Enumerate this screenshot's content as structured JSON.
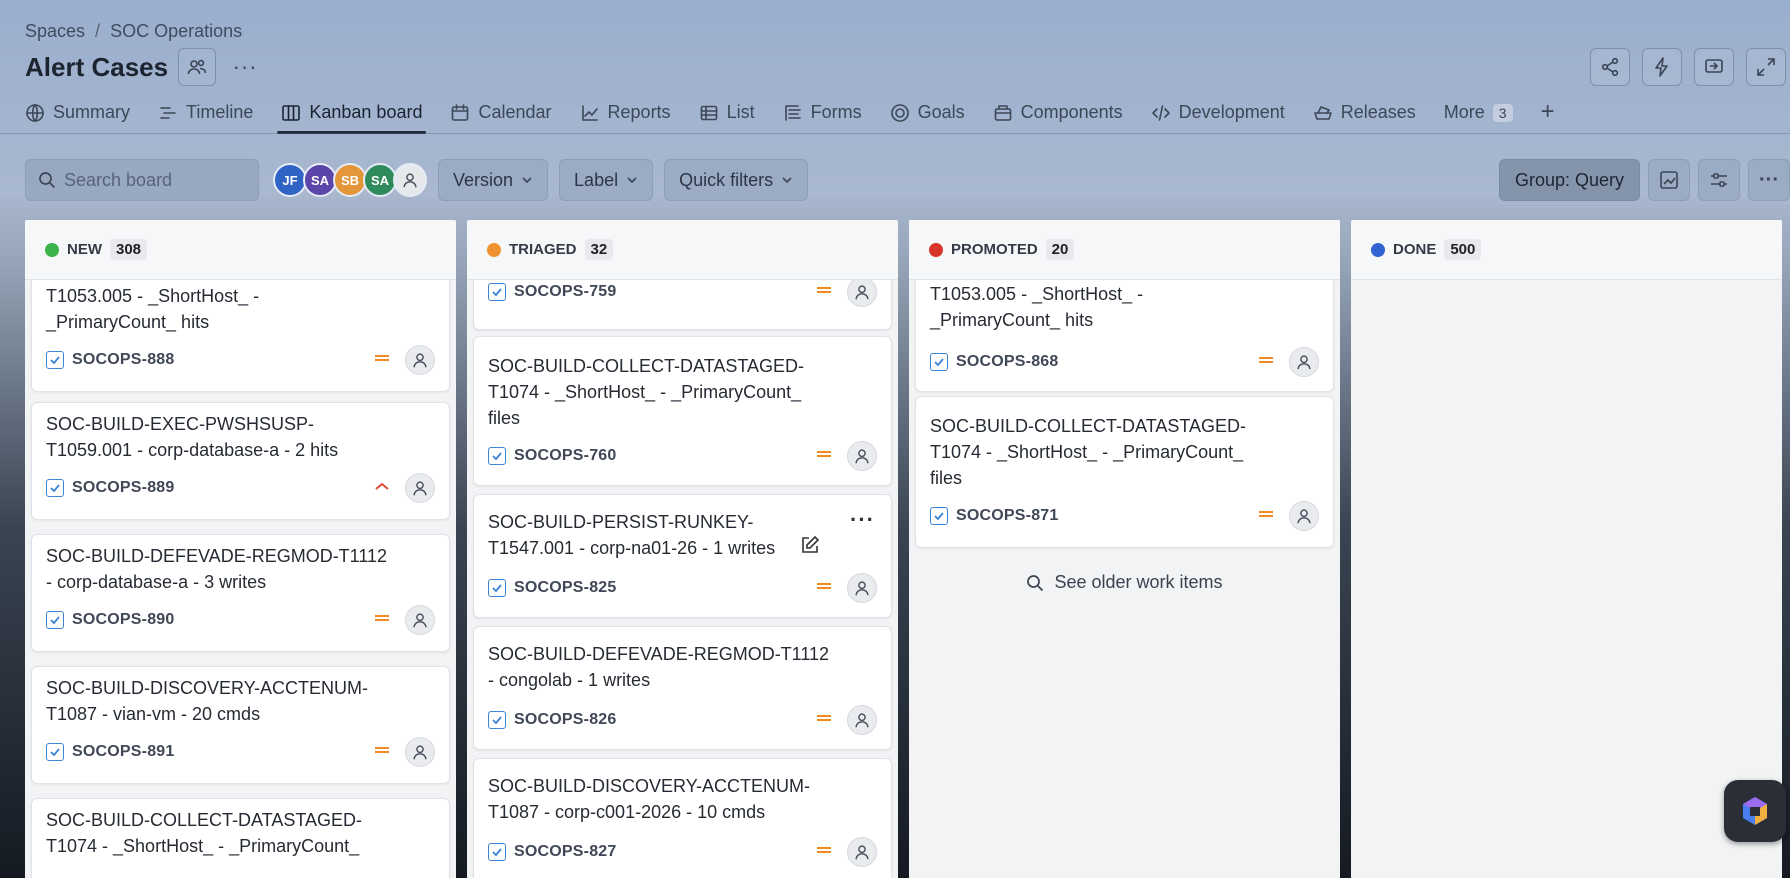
{
  "breadcrumb": {
    "items": [
      "Spaces",
      "SOC Operations"
    ],
    "separator": "/"
  },
  "header": {
    "title": "Alert Cases"
  },
  "tabs": [
    {
      "label": "Summary",
      "icon": "globe-icon"
    },
    {
      "label": "Timeline",
      "icon": "timeline-icon"
    },
    {
      "label": "Kanban board",
      "icon": "board-icon",
      "active": true
    },
    {
      "label": "Calendar",
      "icon": "calendar-icon"
    },
    {
      "label": "Reports",
      "icon": "reports-icon"
    },
    {
      "label": "List",
      "icon": "list-icon"
    },
    {
      "label": "Forms",
      "icon": "forms-icon"
    },
    {
      "label": "Goals",
      "icon": "goals-icon"
    },
    {
      "label": "Components",
      "icon": "components-icon"
    },
    {
      "label": "Development",
      "icon": "code-icon"
    },
    {
      "label": "Releases",
      "icon": "releases-icon"
    }
  ],
  "more_tab": {
    "label": "More",
    "count": "3"
  },
  "toolbar": {
    "search_placeholder": "Search board",
    "avatars": [
      {
        "initials": "JF",
        "color": "#2f63c4"
      },
      {
        "initials": "SA",
        "color": "#5b45a8"
      },
      {
        "initials": "SB",
        "color": "#e3973a"
      },
      {
        "initials": "SA",
        "color": "#2f8a5c"
      }
    ],
    "version_label": "Version",
    "label_label": "Label",
    "quick_filters_label": "Quick filters",
    "group_label": "Group: Query"
  },
  "columns": [
    {
      "name": "NEW",
      "count": "308",
      "color": "#3cb44b",
      "cards": [
        {
          "title_lines": [
            "T1053.005 - _ShortHost_ -",
            "_PrimaryCount_ hits"
          ],
          "key": "SOCOPS-888",
          "priority": "medium"
        },
        {
          "title_lines": [
            "SOC-BUILD-EXEC-PWSHSUSP-",
            "T1059.001 - corp-database-a - 2 hits"
          ],
          "key": "SOCOPS-889",
          "priority": "high"
        },
        {
          "title_lines": [
            "SOC-BUILD-DEFEVADE-REGMOD-T1112",
            "- corp-database-a - 3 writes"
          ],
          "key": "SOCOPS-890",
          "priority": "medium"
        },
        {
          "title_lines": [
            "SOC-BUILD-DISCOVERY-ACCTENUM-",
            "T1087 - vian-vm - 20 cmds"
          ],
          "key": "SOCOPS-891",
          "priority": "medium"
        },
        {
          "title_lines": [
            "SOC-BUILD-COLLECT-DATASTAGED-",
            "T1074 - _ShortHost_ - _PrimaryCount_"
          ],
          "key": "",
          "priority": ""
        }
      ]
    },
    {
      "name": "TRIAGED",
      "count": "32",
      "color": "#f0922f",
      "cards": [
        {
          "title_lines": [],
          "key": "SOCOPS-759",
          "priority": "medium"
        },
        {
          "title_lines": [
            "SOC-BUILD-COLLECT-DATASTAGED-",
            "T1074 - _ShortHost_ - _PrimaryCount_",
            "files"
          ],
          "key": "SOCOPS-760",
          "priority": "medium"
        },
        {
          "title_lines": [
            "SOC-BUILD-PERSIST-RUNKEY-",
            "T1547.001 - corp-na01-26 - 1 writes"
          ],
          "key": "SOCOPS-825",
          "priority": "medium"
        },
        {
          "title_lines": [
            "SOC-BUILD-DEFEVADE-REGMOD-T1112",
            "- congolab - 1 writes"
          ],
          "key": "SOCOPS-826",
          "priority": "medium"
        },
        {
          "title_lines": [
            "SOC-BUILD-DISCOVERY-ACCTENUM-",
            "T1087 - corp-c001-2026 - 10 cmds"
          ],
          "key": "SOCOPS-827",
          "priority": "medium"
        }
      ]
    },
    {
      "name": "PROMOTED",
      "count": "20",
      "color": "#d8342c",
      "cards": [
        {
          "title_lines": [
            "T1053.005 - _ShortHost_ -",
            "_PrimaryCount_ hits"
          ],
          "key": "SOCOPS-868",
          "priority": "medium"
        },
        {
          "title_lines": [
            "SOC-BUILD-COLLECT-DATASTAGED-",
            "T1074 - _ShortHost_ - _PrimaryCount_",
            "files"
          ],
          "key": "SOCOPS-871",
          "priority": "medium"
        }
      ],
      "older_label": "See older work items"
    },
    {
      "name": "DONE",
      "count": "500",
      "color": "#2f63d0",
      "cards": []
    }
  ]
}
